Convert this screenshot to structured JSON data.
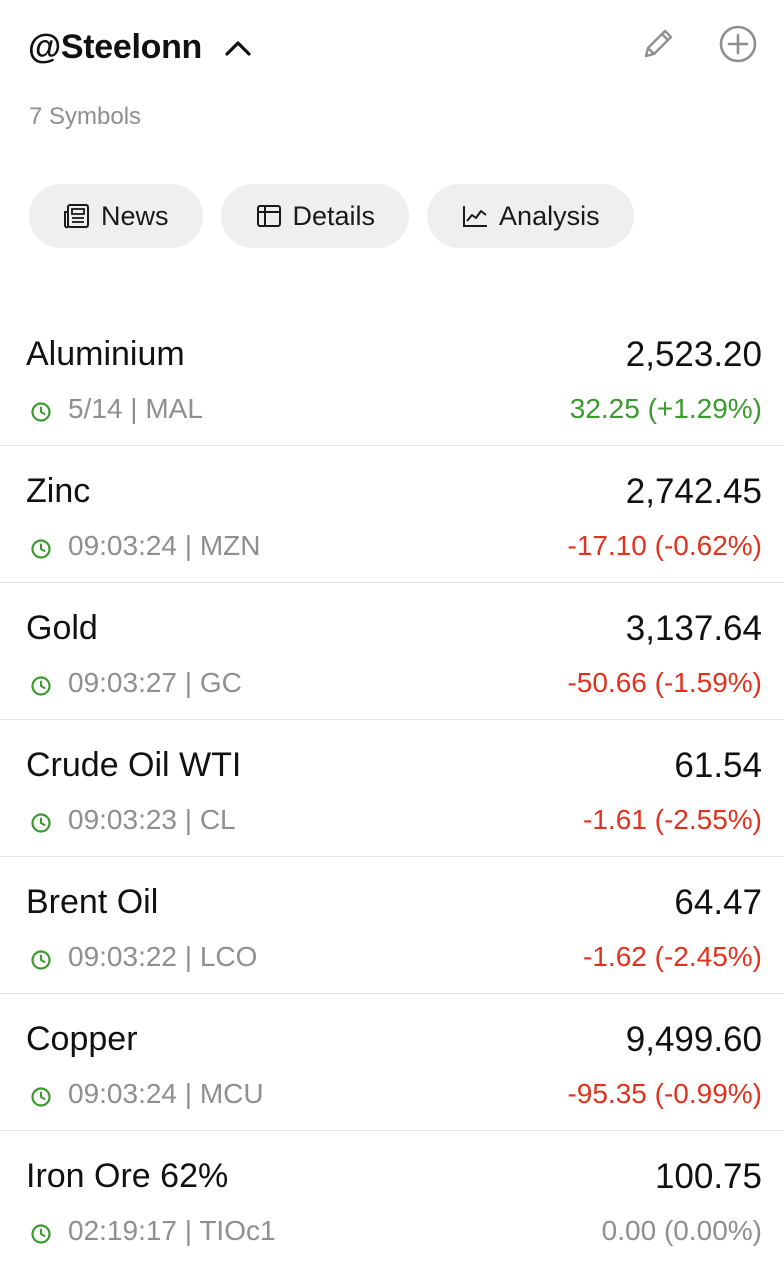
{
  "header": {
    "title": "@Steelonn",
    "subtitle": "7 Symbols",
    "icons": [
      "chevron-up-icon",
      "pencil-icon",
      "plus-circle-icon"
    ]
  },
  "tabs": [
    {
      "label": "News",
      "icon": "newspaper-icon"
    },
    {
      "label": "Details",
      "icon": "table-icon"
    },
    {
      "label": "Analysis",
      "icon": "line-chart-icon"
    }
  ],
  "colors": {
    "positive": "#3a9a2e",
    "negative": "#e0321f",
    "neutral": "#8e8e93",
    "clock": "#3a9a2e"
  },
  "symbols": [
    {
      "name": "Aluminium",
      "price": "2,523.20",
      "time": "5/14",
      "ticker": "MAL",
      "meta": "5/14 | MAL",
      "change": "32.25 (+1.29%)",
      "direction": "positive"
    },
    {
      "name": "Zinc",
      "price": "2,742.45",
      "time": "09:03:24",
      "ticker": "MZN",
      "meta": "09:03:24 | MZN",
      "change": "-17.10 (-0.62%)",
      "direction": "negative"
    },
    {
      "name": "Gold",
      "price": "3,137.64",
      "time": "09:03:27",
      "ticker": "GC",
      "meta": "09:03:27 | GC",
      "change": "-50.66 (-1.59%)",
      "direction": "negative"
    },
    {
      "name": "Crude Oil WTI",
      "price": "61.54",
      "time": "09:03:23",
      "ticker": "CL",
      "meta": "09:03:23 | CL",
      "change": "-1.61 (-2.55%)",
      "direction": "negative"
    },
    {
      "name": "Brent Oil",
      "price": "64.47",
      "time": "09:03:22",
      "ticker": "LCO",
      "meta": "09:03:22 | LCO",
      "change": "-1.62 (-2.45%)",
      "direction": "negative"
    },
    {
      "name": "Copper",
      "price": "9,499.60",
      "time": "09:03:24",
      "ticker": "MCU",
      "meta": "09:03:24 | MCU",
      "change": "-95.35 (-0.99%)",
      "direction": "negative"
    },
    {
      "name": "Iron Ore 62%",
      "price": "100.75",
      "time": "02:19:17",
      "ticker": "TIOc1",
      "meta": "02:19:17 | TIOc1",
      "change": "0.00 (0.00%)",
      "direction": "neutral"
    }
  ]
}
